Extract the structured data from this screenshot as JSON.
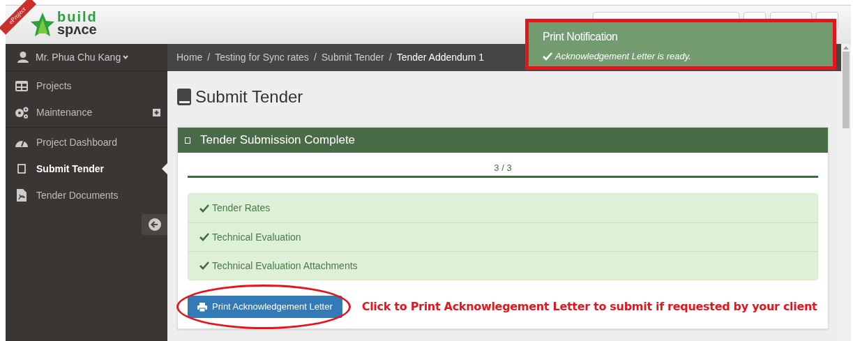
{
  "header": {
    "ribbon": "eProject",
    "logo_top": "build",
    "logo_bottom": "spʌce"
  },
  "user": {
    "name": "Mr. Phua Chu Kang"
  },
  "sidebar": {
    "groups": [
      {
        "items": [
          {
            "label": "Projects",
            "selected": false,
            "expandable": false
          },
          {
            "label": "Maintenance",
            "selected": false,
            "expandable": true
          }
        ]
      },
      {
        "items": [
          {
            "label": "Project Dashboard",
            "selected": false,
            "expandable": false
          },
          {
            "label": "Submit Tender",
            "selected": true,
            "expandable": false
          },
          {
            "label": "Tender Documents",
            "selected": false,
            "expandable": false
          }
        ]
      }
    ]
  },
  "breadcrumb": [
    {
      "label": "Home",
      "current": false
    },
    {
      "separator": "/",
      "label": "Testing for Sync rates",
      "current": false
    },
    {
      "separator": "/",
      "label": "Submit Tender",
      "current": false
    },
    {
      "separator": "/",
      "label": "Tender Addendum 1",
      "current": true
    }
  ],
  "page_title": "Submit Tender",
  "panel": {
    "title": "Tender Submission Complete",
    "progress": {
      "label": "3 / 3",
      "level": 1
    },
    "checklist": [
      {
        "label": "Tender Rates",
        "done": true
      },
      {
        "label": "Technical Evaluation",
        "done": true
      },
      {
        "label": "Technical Evaluation Attachments",
        "done": true
      }
    ],
    "print_button": "Print Acknowledgement Letter"
  },
  "notification": {
    "title": "Print Notification",
    "message": "Acknowledgement Letter is ready."
  },
  "annotation": {
    "text": "Click to Print Acknowlegement Letter to submit if requested by your client"
  }
}
